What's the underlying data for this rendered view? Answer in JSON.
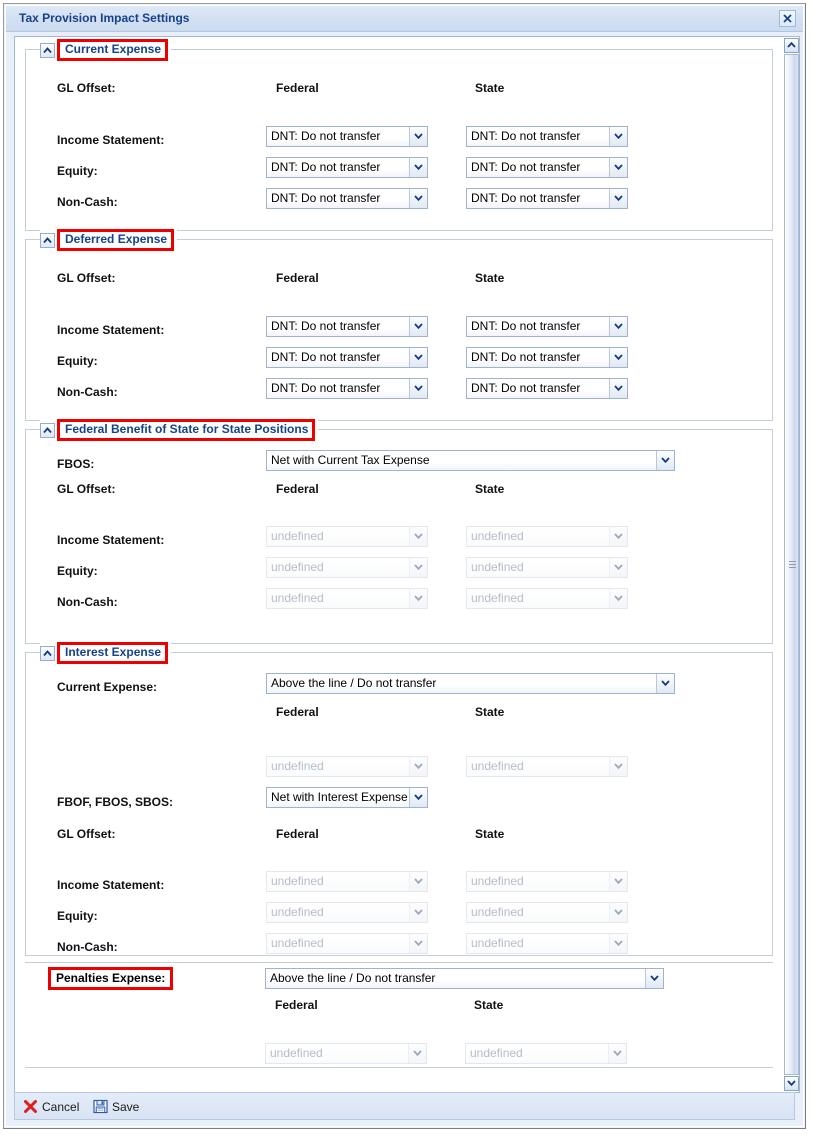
{
  "window": {
    "title": "Tax Provision Impact Settings",
    "close_icon": "close-icon"
  },
  "columns": {
    "federal": "Federal",
    "state": "State"
  },
  "labels": {
    "gl_offset": "GL Offset:",
    "income_statement": "Income Statement:",
    "equity": "Equity:",
    "non_cash": "Non-Cash:",
    "fbos": "FBOS:",
    "current_expense": "Current Expense:",
    "fbof_fbos_sbos": "FBOF, FBOS, SBOS:",
    "penalties_expense": "Penalties Expense:"
  },
  "values": {
    "dnt": "DNT: Do not transfer",
    "undefined": "undefined",
    "net_with_current_tax_expense": "Net with Current Tax Expense",
    "above_the_line": "Above the line / Do not transfer",
    "net_with_interest_expense": "Net with Interest Expense"
  },
  "sections": [
    {
      "id": "current-expense",
      "title": "Current Expense",
      "toggle_icon": "chevron-up-icon"
    },
    {
      "id": "deferred-expense",
      "title": "Deferred Expense",
      "toggle_icon": "chevron-up-icon"
    },
    {
      "id": "federal-benefit-of-state",
      "title": "Federal Benefit of State for State Positions",
      "toggle_icon": "chevron-up-icon"
    },
    {
      "id": "interest-expense",
      "title": "Interest Expense",
      "toggle_icon": "chevron-up-icon"
    }
  ],
  "footer": {
    "cancel_label": "Cancel",
    "save_label": "Save",
    "cancel_icon": "red-x-icon",
    "save_icon": "floppy-disk-icon"
  },
  "scrollbar": {
    "up_icon": "chevron-up-icon",
    "down_icon": "chevron-down-icon",
    "grip_icon": "grip-icon"
  },
  "colors": {
    "legend_text": "#15428b",
    "highlight_border": "#ee0000",
    "title_text": "#15428b",
    "disabled_text": "#b6bcc7"
  }
}
